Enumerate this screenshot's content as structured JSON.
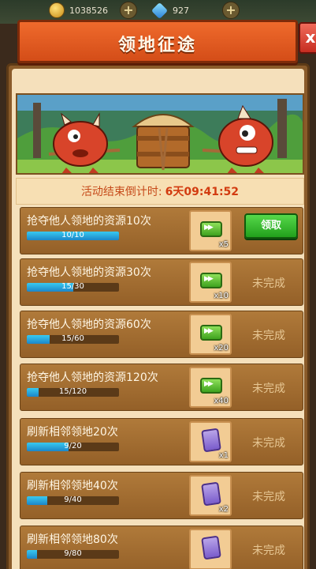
{
  "topbar": {
    "gold_value": "1038526",
    "gem_value": "927",
    "plus": "+"
  },
  "title": "领地征途",
  "close_label": "x",
  "countdown": {
    "label": "活动结束倒计时:",
    "value": "6天09:41:52"
  },
  "tasks": [
    {
      "label": "抢夺他人领地的资源10次",
      "progress_text": "10/10",
      "progress": 1.0,
      "reward_type": "ticket-icon",
      "reward_count": "x5",
      "state": "claim",
      "action_label": "领取"
    },
    {
      "label": "抢夺他人领地的资源30次",
      "progress_text": "15/30",
      "progress": 0.5,
      "reward_type": "ticket-icon",
      "reward_count": "x10",
      "state": "incomplete",
      "action_label": "未完成"
    },
    {
      "label": "抢夺他人领地的资源60次",
      "progress_text": "15/60",
      "progress": 0.25,
      "reward_type": "ticket-icon",
      "reward_count": "x20",
      "state": "incomplete",
      "action_label": "未完成"
    },
    {
      "label": "抢夺他人领地的资源120次",
      "progress_text": "15/120",
      "progress": 0.125,
      "reward_type": "ticket-icon",
      "reward_count": "x40",
      "state": "incomplete",
      "action_label": "未完成"
    },
    {
      "label": "刷新相邻领地20次",
      "progress_text": "9/20",
      "progress": 0.45,
      "reward_type": "card-icon",
      "reward_count": "x1",
      "state": "incomplete",
      "action_label": "未完成"
    },
    {
      "label": "刷新相邻领地40次",
      "progress_text": "9/40",
      "progress": 0.225,
      "reward_type": "card-icon",
      "reward_count": "x2",
      "state": "incomplete",
      "action_label": "未完成"
    },
    {
      "label": "刷新相邻领地80次",
      "progress_text": "9/80",
      "progress": 0.1125,
      "reward_type": "card-icon",
      "reward_count": "",
      "state": "incomplete",
      "action_label": "未完成"
    }
  ],
  "colors": {
    "accent": "#d44d18",
    "panel": "#8a5b2a",
    "progress": "#1c86c8",
    "claim": "#22a01c"
  }
}
